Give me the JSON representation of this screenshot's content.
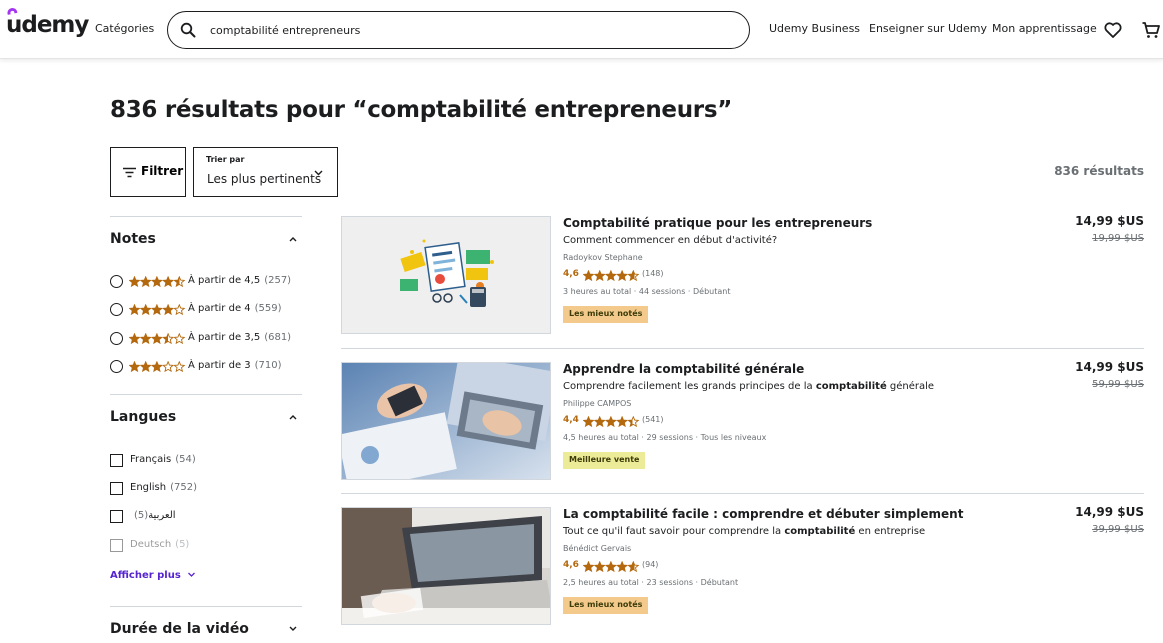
{
  "header": {
    "logo": "udemy",
    "categories": "Catégories",
    "search_value": "comptabilité entrepreneurs",
    "links": [
      "Udemy Business",
      "Enseigner sur Udemy",
      "Mon apprentissage"
    ],
    "icons": [
      "heart-icon",
      "cart-icon"
    ]
  },
  "main": {
    "title": "836 résultats pour “comptabilité entrepreneurs”",
    "filter_label": "Filtrer",
    "sort_caption": "Trier par",
    "sort_value": "Les plus pertinents",
    "result_count": "836 résultats"
  },
  "sidebar": {
    "ratings": {
      "title": "Notes",
      "items": [
        {
          "label": "À partir de 4,5",
          "count": "(257)",
          "stars": 4.5
        },
        {
          "label": "À partir de 4",
          "count": "(559)",
          "stars": 4
        },
        {
          "label": "À partir de 3,5",
          "count": "(681)",
          "stars": 3.5
        },
        {
          "label": "À partir de 3",
          "count": "(710)",
          "stars": 3
        }
      ]
    },
    "languages": {
      "title": "Langues",
      "items": [
        {
          "label": "Français",
          "count": "(54)"
        },
        {
          "label": "English",
          "count": "(752)"
        },
        {
          "label": "العربية",
          "count": "(5)"
        },
        {
          "label": "Deutsch",
          "count": "(5)"
        }
      ],
      "show_more": "Afficher plus"
    },
    "duration": {
      "title": "Durée de la vidéo"
    }
  },
  "courses": [
    {
      "title": "Comptabilité pratique pour les entrepreneurs",
      "headline": "Comment commencer en début d'activité?",
      "headline_bold": "",
      "headline_after": "",
      "instructor": "Radoykov Stephane",
      "rating": "4,6",
      "stars": 4.6,
      "reviews": "(148)",
      "meta": "3 heures au total · 44 sessions · Débutant",
      "badge": "Les mieux notés",
      "badge_type": "top",
      "price": "14,99 $US",
      "original_price": "19,99 $US"
    },
    {
      "title": "Apprendre la comptabilité générale",
      "headline": "Comprendre facilement les grands principes de la ",
      "headline_bold": "comptabilité",
      "headline_after": " générale",
      "instructor": "Philippe CAMPOS",
      "rating": "4,4",
      "stars": 4.4,
      "reviews": "(541)",
      "meta": "4,5 heures au total · 29 sessions · Tous les niveaux",
      "badge": "Meilleure vente",
      "badge_type": "best",
      "price": "14,99 $US",
      "original_price": "59,99 $US"
    },
    {
      "title": "La comptabilité facile : comprendre et débuter simplement",
      "headline": "Tout ce qu'il faut savoir pour comprendre la ",
      "headline_bold": "comptabilité",
      "headline_after": " en entreprise",
      "instructor": "Bénédict Gervais",
      "rating": "4,6",
      "stars": 4.6,
      "reviews": "(94)",
      "meta": "2,5 heures au total · 23 sessions · Débutant",
      "badge": "Les mieux notés",
      "badge_type": "top",
      "price": "14,99 $US",
      "original_price": "39,99 $US"
    }
  ],
  "colors": {
    "brand": "#a435f0",
    "star": "#b4690e",
    "link": "#5624d0"
  }
}
